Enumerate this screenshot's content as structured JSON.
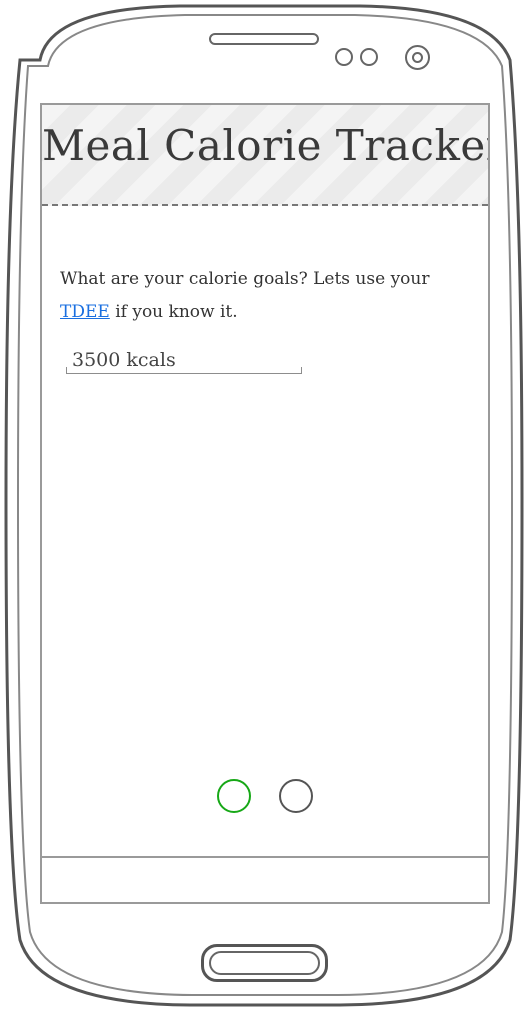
{
  "app": {
    "title": "Meal Calorie Tracker"
  },
  "onboarding": {
    "prompt_before_link": "What are your calorie goals? Lets use your ",
    "link_text": "TDEE",
    "prompt_after_link": " if you know it.",
    "calorie_input_value": "3500 kcals"
  },
  "pager": {
    "total_pages": 2,
    "active_page": 1
  },
  "colors": {
    "accent_link": "#1a6fe0",
    "active_dot": "#17a817",
    "frame": "#555555"
  },
  "icons": {
    "camera": "camera-icon",
    "sensor": "sensor-icon",
    "speaker": "speaker-grille"
  }
}
